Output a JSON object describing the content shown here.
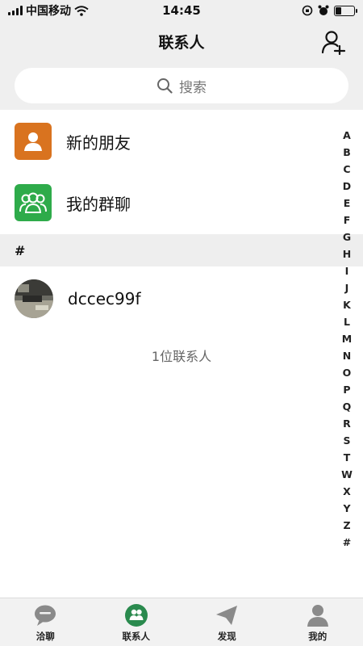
{
  "status_bar": {
    "carrier": "中国移动",
    "time": "14:45",
    "battery_level": 0.3
  },
  "nav": {
    "title": "联系人"
  },
  "search": {
    "placeholder": "搜索"
  },
  "entries": [
    {
      "label": "新的朋友",
      "icon": "person-icon",
      "color": "#d9731f"
    },
    {
      "label": "我的群聊",
      "icon": "group-icon",
      "color": "#2eab4a"
    }
  ],
  "section": {
    "header": "#"
  },
  "contacts": [
    {
      "name": "dccec99f"
    }
  ],
  "contact_count": "1位联系人",
  "index_letters": [
    "A",
    "B",
    "C",
    "D",
    "E",
    "F",
    "G",
    "H",
    "I",
    "J",
    "K",
    "L",
    "M",
    "N",
    "O",
    "P",
    "Q",
    "R",
    "S",
    "T",
    "W",
    "X",
    "Y",
    "Z",
    "#"
  ],
  "tabs": [
    {
      "label": "洽聊",
      "icon": "chat-bubble-icon",
      "active": false
    },
    {
      "label": "联系人",
      "icon": "contacts-icon",
      "active": true
    },
    {
      "label": "发现",
      "icon": "paper-plane-icon",
      "active": false
    },
    {
      "label": "我的",
      "icon": "profile-icon",
      "active": false
    }
  ],
  "colors": {
    "accent": "#2a8a4e",
    "inactive_icon": "#8a8a8a",
    "header_bg": "#efefef"
  }
}
